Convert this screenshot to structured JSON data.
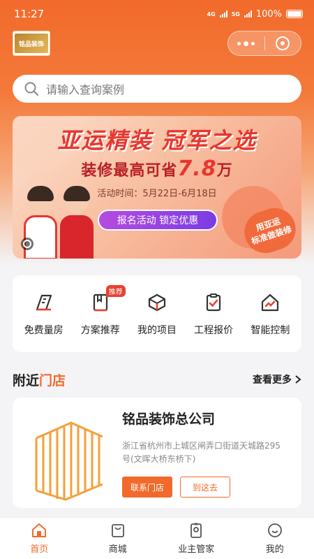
{
  "status_bar": {
    "time": "11:27",
    "network1": "4G",
    "network2": "5G",
    "battery": "100%"
  },
  "logo": {
    "text": "铭品装饰"
  },
  "search": {
    "placeholder": "请输入查询案例"
  },
  "banner": {
    "title": "亚运精装 冠军之选",
    "subtitle_prefix": "装修最高可省",
    "subtitle_amount": "7.8",
    "subtitle_suffix": "万",
    "date": "活动时间：5月22日-6月18日",
    "button": "报名活动 锁定优惠",
    "stamp_line1": "用亚运",
    "stamp_line2": "标准做装修"
  },
  "quick_actions": [
    {
      "label": "免费量房",
      "icon": "ruler-icon"
    },
    {
      "label": "方案推荐",
      "icon": "book-icon",
      "badge": "推荐"
    },
    {
      "label": "我的项目",
      "icon": "box-icon"
    },
    {
      "label": "工程报价",
      "icon": "clipboard-icon"
    },
    {
      "label": "智能控制",
      "icon": "smart-home-icon"
    }
  ],
  "nearby": {
    "title_plain": "附近",
    "title_accent": "门店",
    "more": "查看更多"
  },
  "store": {
    "name": "铭品装饰总公司",
    "address": "浙江省杭州市上城区闸弄口街道天城路295号(文晖大桥东桥下)",
    "contact_button": "联系门店",
    "go_button": "到这去"
  },
  "tabbar": [
    {
      "label": "首页",
      "icon": "home-icon",
      "active": true
    },
    {
      "label": "商城",
      "icon": "shop-bag-icon"
    },
    {
      "label": "业主管家",
      "icon": "badge-icon"
    },
    {
      "label": "我的",
      "icon": "smile-icon"
    }
  ],
  "colors": {
    "accent": "#f26a2b",
    "badge": "#e8412f",
    "banner_red": "#e8362e"
  }
}
